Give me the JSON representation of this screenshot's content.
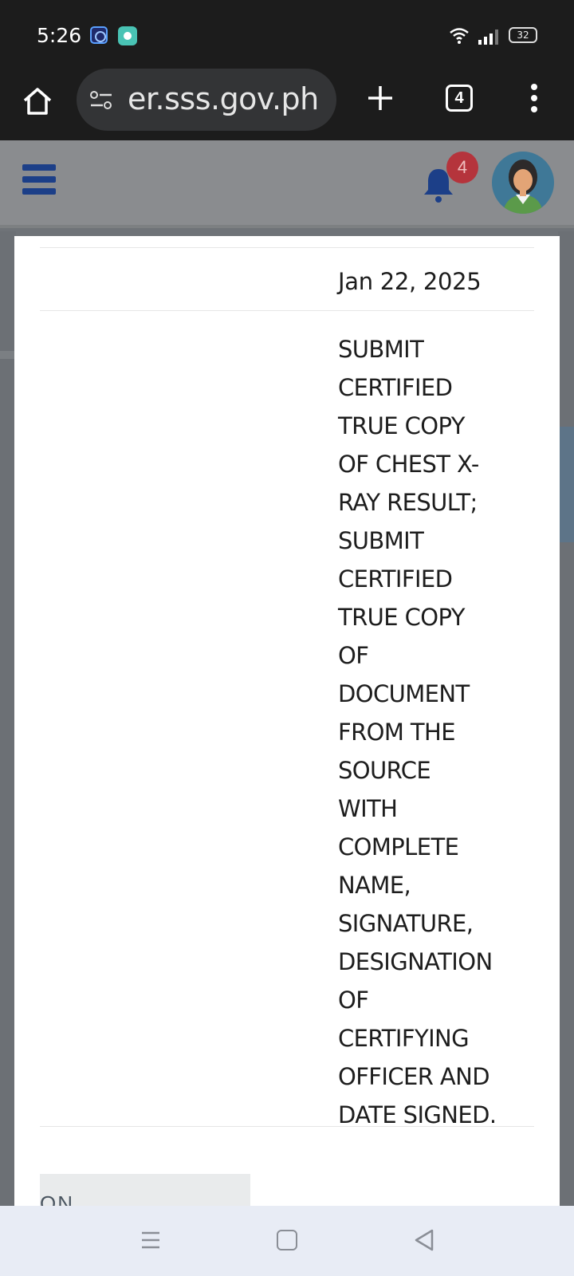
{
  "status_bar": {
    "time": "5:26",
    "battery": "32",
    "icons": [
      "app-notification-icon",
      "chat-notification-icon",
      "wifi-icon",
      "signal-icon",
      "battery-icon"
    ]
  },
  "browser": {
    "url": "er.sss.gov.ph",
    "tab_count": "4",
    "icons": [
      "home-icon",
      "site-settings-icon",
      "new-tab-icon",
      "overflow-menu-icon"
    ]
  },
  "site_header": {
    "notification_count": "4",
    "icons": [
      "hamburger-menu-icon",
      "bell-icon",
      "avatar"
    ]
  },
  "record": {
    "date": "Jan 22, 2025",
    "remarks_lines": [
      "SUBMIT",
      "CERTIFIED",
      "TRUE COPY",
      "OF CHEST X-",
      "RAY RESULT;",
      "SUBMIT",
      "CERTIFIED",
      "TRUE COPY",
      "OF",
      "DOCUMENT",
      "FROM THE",
      "SOURCE",
      "WITH",
      "COMPLETE",
      "NAME,",
      "SIGNATURE,",
      "DESIGNATION",
      "OF",
      "CERTIFYING",
      "OFFICER AND",
      "DATE SIGNED."
    ],
    "next_cell_partial": "ON"
  },
  "colors": {
    "status_bg": "#1c1c1c",
    "header_brand": "#1c3f88",
    "badge_red": "#b5343c",
    "nav_bg": "#e8ecf5"
  }
}
